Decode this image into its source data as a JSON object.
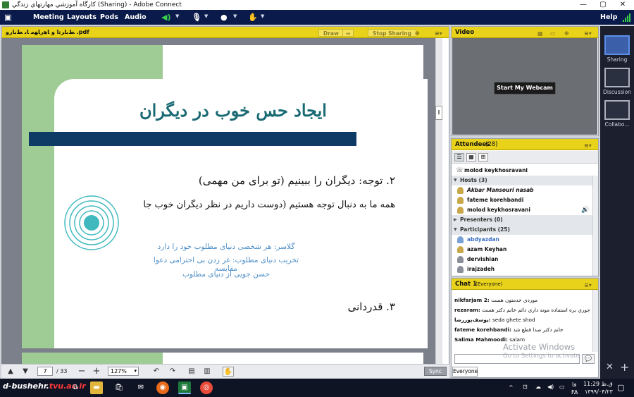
{
  "window": {
    "title": "كارگاه آموزشي مهارتهاي زندگي (Sharing) - Adobe Connect",
    "minimize": "—",
    "maximize": "▢",
    "close": "✕"
  },
  "menubar": {
    "items": [
      "Meeting",
      "Layouts",
      "Pods",
      "Audio"
    ],
    "help": "Help"
  },
  "share_pod": {
    "title": "ﻂ‌ﺑﺎﺮﺗ‌ا و ﺎﻫﺭﺎﻬﻣ ﺎﺑ ﻂ‌ﺑﺎﺭﻭ ‌‌‌‌.pdf",
    "draw_label": "Draw",
    "stop_sharing_label": "Stop Sharing",
    "sync_label": "Sync",
    "current_page": "7",
    "total_pages": "/ 33",
    "zoom": "127%"
  },
  "slide": {
    "title": "ایجاد حس خوب در دیگران",
    "point2": "۲. توجه: دیگران را ببینیم (تو برای من مهمی)",
    "point2_sub": "همه ما به دنبال توجه هستیم (دوست داریم در نظر دیگران خوب جا",
    "list": [
      "گلاسر: هر شخصی دنیای مطلوب خود را دارد",
      "تخریب دنیای مطلوب: غر زدن بی احترامی دعوا مقایسه",
      "حسن جویی از دنیای مطلوب"
    ],
    "point3": "۳. قدردانی"
  },
  "video_pod": {
    "title": "Video",
    "webcam_label": "Start My Webcam"
  },
  "attendees_pod": {
    "title": "Attendees",
    "count": "(28)",
    "me": "molod keykhosravani",
    "hosts_header": "Hosts (3)",
    "hosts": [
      "Akbar Mansouri nasab",
      "fateme korehbandi",
      "molod keykhosravani"
    ],
    "presenters_header": "Presenters (0)",
    "participants_header": "Participants (25)",
    "participants": [
      "abdyazdan",
      "azam Keyhan",
      "dervishian",
      "irajzadeh"
    ]
  },
  "chat_pod": {
    "title": "Chat 1",
    "scope": "(Everyone)",
    "messages": [
      {
        "sender": "nikfarjam 2:",
        "text": "موردي خدمتون هست"
      },
      {
        "sender": "rezaram:",
        "text": "جوري بره استفاده مونه داري دائم خانم دكتر هست"
      },
      {
        "sender": "يوسف‌پور‌رضا:",
        "text": "seda ghete shod"
      },
      {
        "sender": "fateme korehbandi:",
        "text": "خانم دكتر صدا قطع شد"
      },
      {
        "sender": "Salima Mahmoodi:",
        "text": "salam"
      }
    ],
    "tab_label": "Everyone"
  },
  "watermark": {
    "line1": "Activate Windows",
    "line2": "Go to Settings to activate"
  },
  "layouts": [
    {
      "label": "Sharing"
    },
    {
      "label": "Discussion"
    },
    {
      "label": "Collabo..."
    }
  ],
  "taskbar": {
    "brand_a": "d-bushehr.",
    "brand_b": "tvu.ac.ir",
    "time": "11:29 ق.ظ",
    "date": "۱۳۹۹/۰۴/۲۳",
    "lang": "FA",
    "lang2": "فا"
  }
}
